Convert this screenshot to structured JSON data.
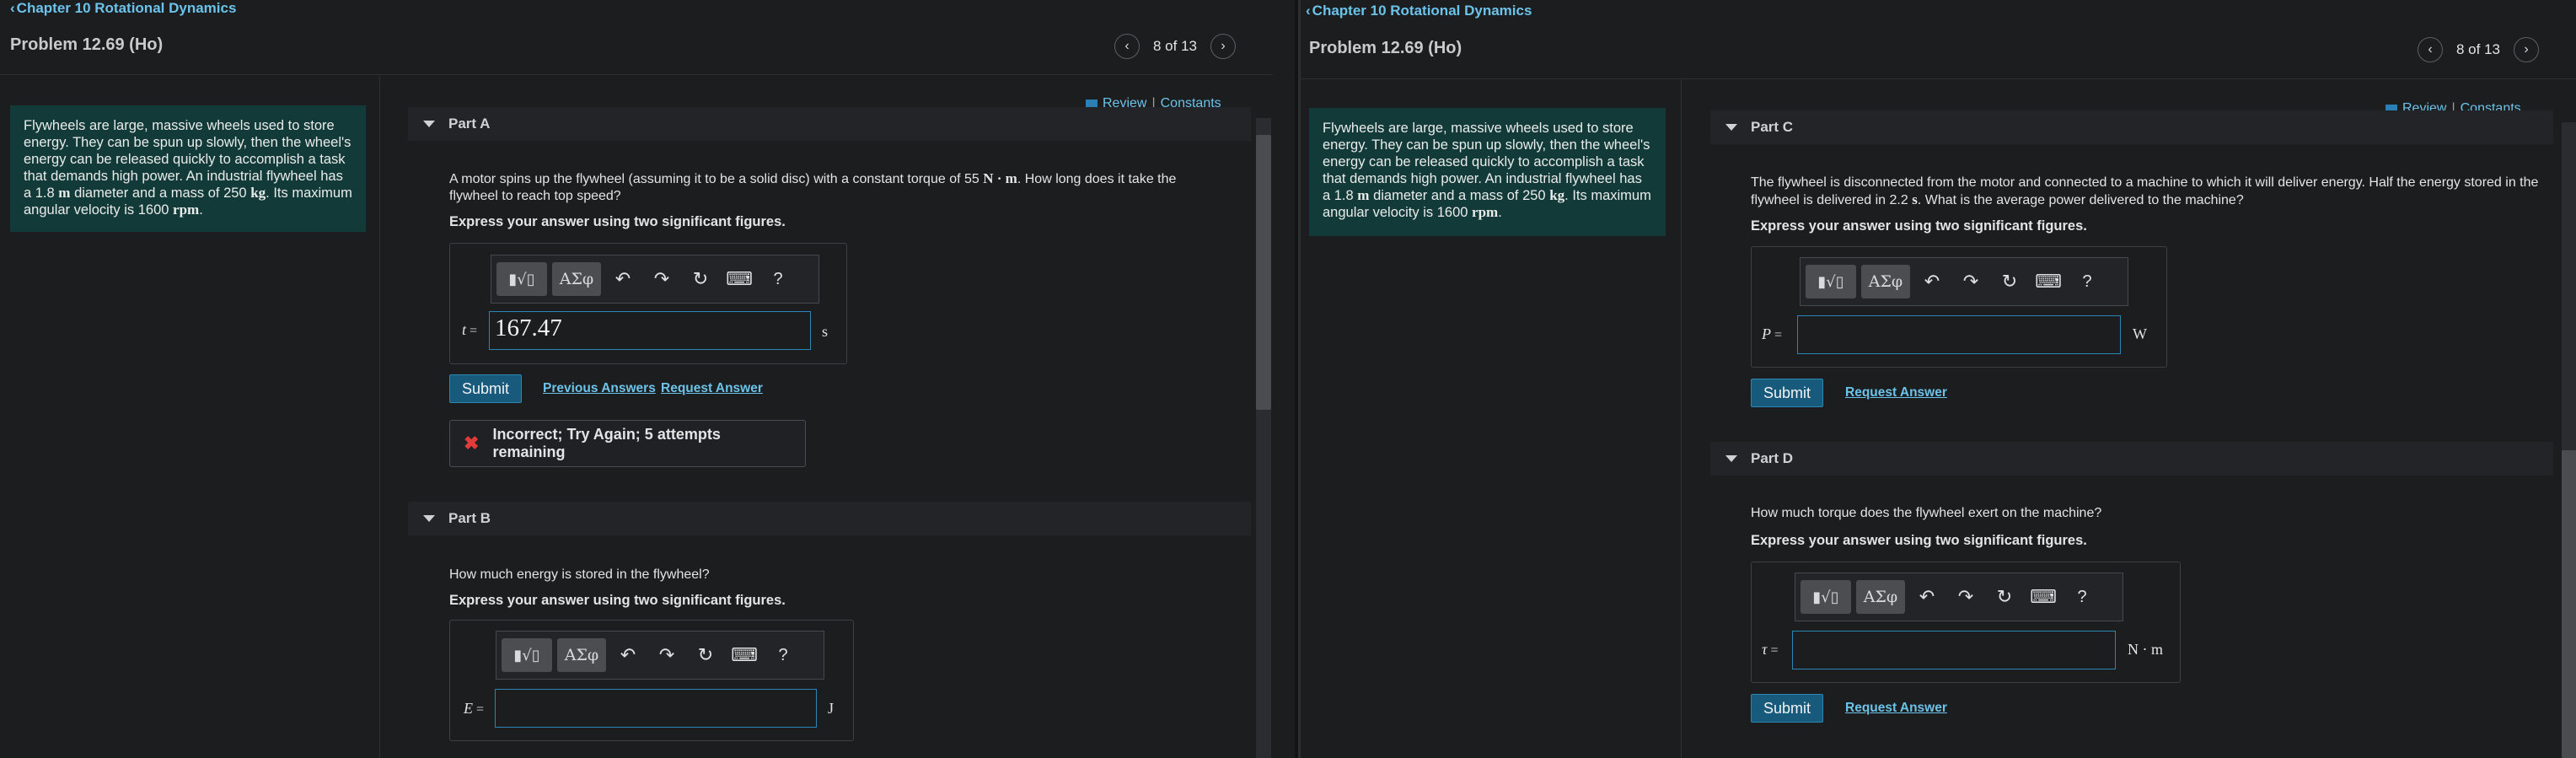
{
  "left": {
    "chapter_link": "Chapter 10 Rotational Dynamics",
    "problem_title": "Problem 12.69 (Ho)",
    "pager": {
      "position": "8 of 13"
    },
    "story": {
      "t1": "Flywheels are large, massive wheels used to store energy. They can be spun up slowly, then the wheel's energy can be released quickly to accomplish a task that demands high power. An industrial flywheel has a 1.8",
      "u1": "m",
      "t2": "diameter and a mass of 250",
      "u2": "kg",
      "t3": ". Its maximum angular velocity is 1600",
      "u3": "rpm",
      "t4": "."
    },
    "review": "Review",
    "separator": "|",
    "constants": "Constants",
    "partA": {
      "label": "Part A",
      "q1": "A motor spins up the flywheel (assuming it to be a solid disc) with a constant torque of 55",
      "qunit": "N · m",
      "q2": ". How long does it take the flywheel to reach top speed?",
      "hint": "Express your answer using two significant figures.",
      "var": "t",
      "eq": "=",
      "value": "167.47",
      "unit": "s",
      "submit": "Submit",
      "prev": "Previous Answers",
      "request": "Request Answer",
      "feedback": "Incorrect; Try Again; 5 attempts remaining"
    },
    "partB": {
      "label": "Part B",
      "q": "How much energy is stored in the flywheel?",
      "hint": "Express your answer using two significant figures.",
      "var": "E",
      "eq": "=",
      "unit": "J"
    }
  },
  "right": {
    "chapter_link": "Chapter 10 Rotational Dynamics",
    "problem_title": "Problem 12.69 (Ho)",
    "pager": {
      "position": "8 of 13"
    },
    "story": {
      "t1": "Flywheels are large, massive wheels used to store energy. They can be spun up slowly, then the wheel's energy can be released quickly to accomplish a task that demands high power. An industrial flywheel has a 1.8",
      "u1": "m",
      "t2": "diameter and a mass of 250",
      "u2": "kg",
      "t3": ". Its maximum angular velocity is 1600",
      "u3": "rpm",
      "t4": "."
    },
    "review": "Review",
    "separator": "|",
    "constants": "Constants",
    "partC": {
      "label": "Part C",
      "q1": "The flywheel is disconnected from the motor and connected to a machine to which it will deliver energy. Half the energy stored in the flywheel is delivered in 2.2",
      "qunit": "s",
      "q2": ". What is the average power delivered to the machine?",
      "hint": "Express your answer using two significant figures.",
      "var": "P",
      "eq": "=",
      "unit": "W",
      "submit": "Submit",
      "request": "Request Answer"
    },
    "partD": {
      "label": "Part D",
      "q": "How much torque does the flywheel exert on the machine?",
      "hint": "Express your answer using two significant figures.",
      "var": "τ",
      "eq": "=",
      "unit": "N · m",
      "submit": "Submit",
      "request": "Request Answer"
    }
  },
  "toolbar": {
    "template_label": "▮√▯",
    "symbols_label": "ΑΣφ",
    "undo_icon": "undo-icon",
    "redo_icon": "redo-icon",
    "reset_icon": "reset-icon",
    "keyboard_icon": "keyboard-icon",
    "help_label": "?"
  },
  "colors": {
    "background": "#1c1d1f",
    "story_bg": "#123a38",
    "link": "#6cc3ea",
    "submit_bg": "#175a7c",
    "input_border": "#2b86b4",
    "error": "#e23b3b"
  }
}
